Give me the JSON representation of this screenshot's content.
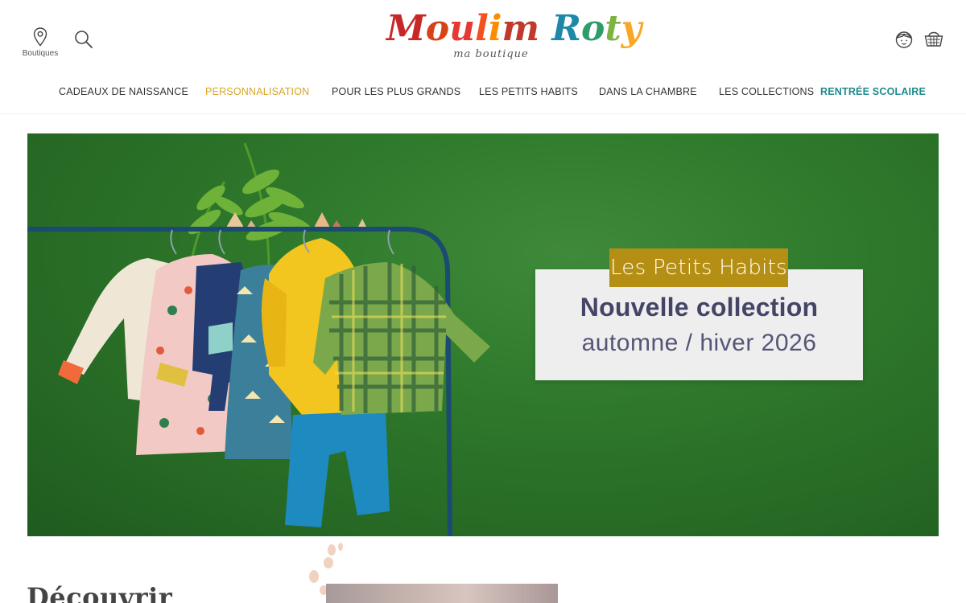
{
  "header": {
    "store_label": "Boutiques",
    "logo_sub": "ma boutique",
    "logo_letters": [
      {
        "ch": "M",
        "color": "#c62828"
      },
      {
        "ch": "o",
        "color": "#d84315"
      },
      {
        "ch": "u",
        "color": "#e53935"
      },
      {
        "ch": "l",
        "color": "#f4511e"
      },
      {
        "ch": "i",
        "color": "#fb8c00"
      },
      {
        "ch": "m",
        "color": "#c0392b"
      },
      {
        "ch": " ",
        "color": "#ffffff"
      },
      {
        "ch": "R",
        "color": "#1e88a8"
      },
      {
        "ch": "o",
        "color": "#2e9d6b"
      },
      {
        "ch": "t",
        "color": "#7cb342"
      },
      {
        "ch": "y",
        "color": "#f9a825"
      }
    ]
  },
  "nav": [
    {
      "label": "CADEAUX DE NAISSANCE",
      "style": "default"
    },
    {
      "label": "PERSONNALISATION",
      "style": "accent"
    },
    {
      "label": "POUR LES PLUS GRANDS",
      "style": "default"
    },
    {
      "label": "LES PETITS HABITS",
      "style": "default"
    },
    {
      "label": "DANS LA CHAMBRE",
      "style": "default"
    },
    {
      "label": "LES COLLECTIONS",
      "style": "default"
    },
    {
      "label": "RENTRÉE SCOLAIRE",
      "style": "teal"
    }
  ],
  "hero": {
    "tag": "Les Petits Habits",
    "title": "Nouvelle collection",
    "subtitle": "automne / hiver 2026",
    "colors": {
      "background": "#2f7a2c",
      "tag": "#b58f14",
      "title": "#444466"
    }
  },
  "discover": {
    "title": "Découvrir"
  }
}
